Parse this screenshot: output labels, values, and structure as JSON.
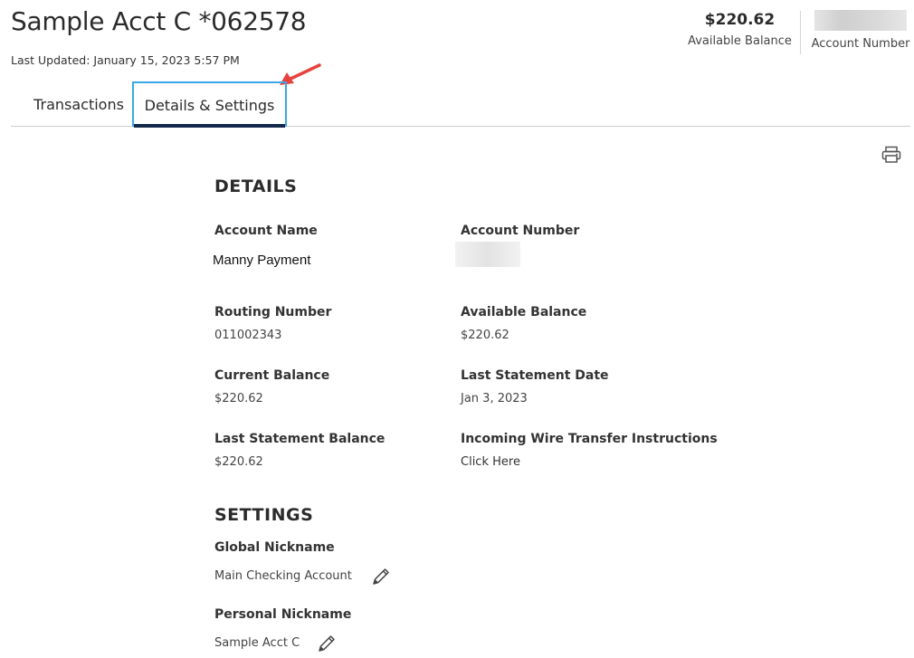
{
  "header": {
    "title": "Sample Acct C *062578",
    "last_updated": "Last Updated: January 15, 2023 5:57 PM",
    "balance_amount": "$220.62",
    "balance_label": "Available Balance",
    "account_number_label": "Account Number"
  },
  "tabs": [
    {
      "label": "Transactions",
      "active": false
    },
    {
      "label": "Details & Settings",
      "active": true
    }
  ],
  "icons": {
    "print": "printer-icon",
    "edit": "pencil-icon",
    "annotation": "red-arrow"
  },
  "colors": {
    "active_tab_border": "#3aa8e6",
    "active_tab_underline": "#13294b",
    "annotation_arrow": "#e8423f"
  },
  "details": {
    "heading": "DETAILS",
    "fields": [
      {
        "label": "Account Name",
        "value": "Manny Payment"
      },
      {
        "label": "Account Number",
        "value": ""
      },
      {
        "label": "Routing Number",
        "value": "011002343"
      },
      {
        "label": "Available Balance",
        "value": "$220.62"
      },
      {
        "label": "Current Balance",
        "value": "$220.62"
      },
      {
        "label": "Last Statement Date",
        "value": "Jan 3, 2023"
      },
      {
        "label": "Last Statement Balance",
        "value": "$220.62"
      },
      {
        "label": "Incoming Wire Transfer Instructions",
        "value": "Click Here"
      }
    ]
  },
  "settings": {
    "heading": "SETTINGS",
    "global_nickname_label": "Global Nickname",
    "global_nickname_value": "Main Checking Account",
    "personal_nickname_label": "Personal Nickname",
    "personal_nickname_value": "Sample Acct C"
  }
}
